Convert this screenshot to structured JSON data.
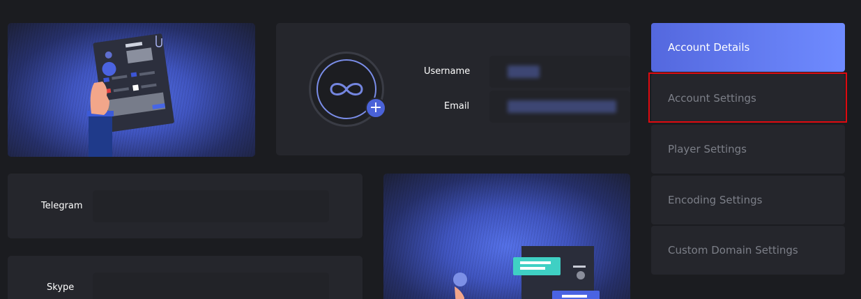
{
  "profile": {
    "username_label": "Username",
    "email_label": "Email",
    "avatar_add_symbol": "+"
  },
  "contacts": {
    "telegram_label": "Telegram",
    "skype_label": "Skype"
  },
  "sidebar": {
    "items": [
      {
        "label": "Account Details",
        "active": true
      },
      {
        "label": "Account Settings",
        "active": false,
        "highlighted": true
      },
      {
        "label": "Player Settings",
        "active": false
      },
      {
        "label": "Encoding Settings",
        "active": false
      },
      {
        "label": "Custom Domain Settings",
        "active": false
      }
    ]
  },
  "colors": {
    "accent": "#5468de",
    "accent_light": "#6f8bff",
    "highlight_border": "#e00a10",
    "card_bg": "#25262c",
    "page_bg": "#1b1c20"
  }
}
